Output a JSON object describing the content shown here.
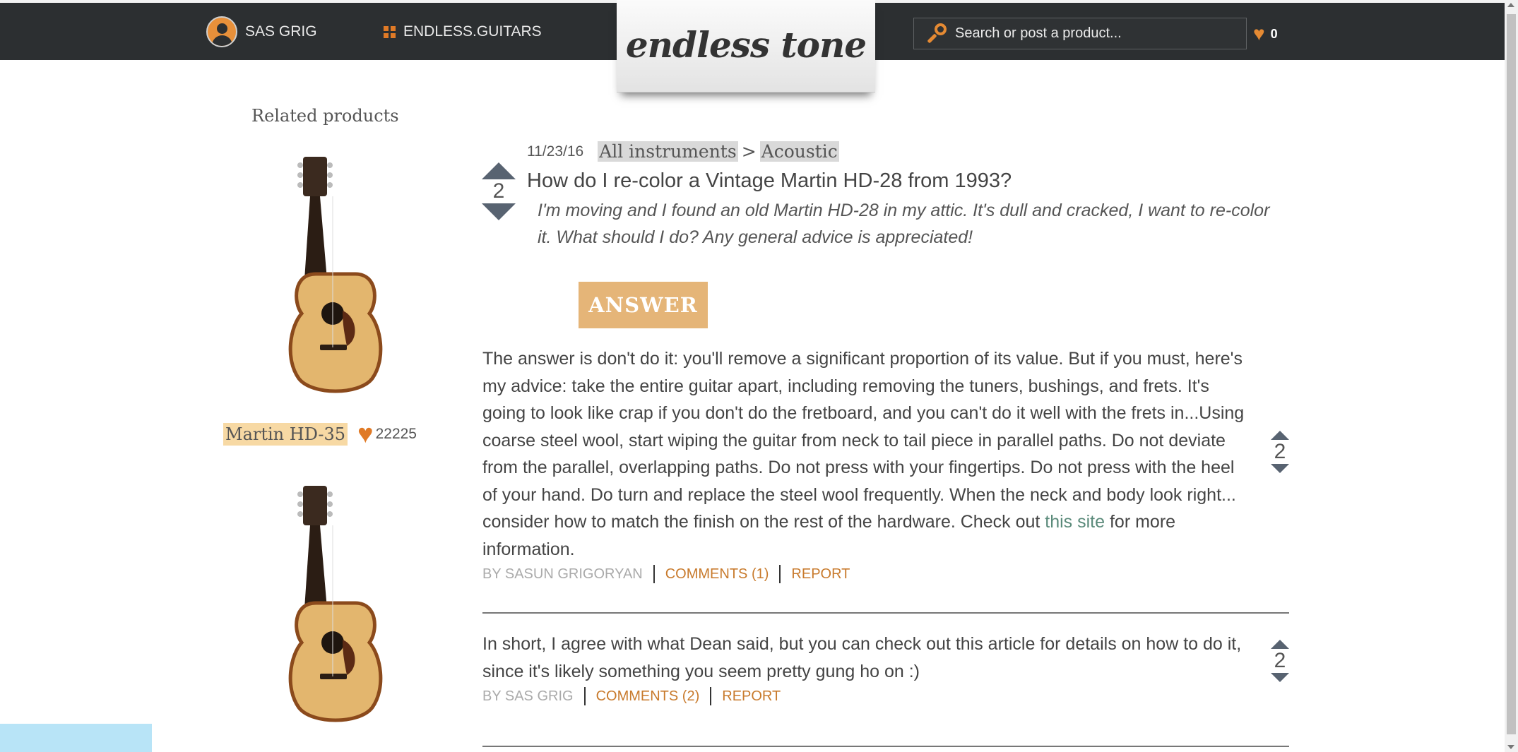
{
  "header": {
    "user_name": "SAS GRIG",
    "store_name": "ENDLESS.GUITARS",
    "logo_text": "endless tone",
    "search": {
      "placeholder": "Search or post a product..."
    },
    "favorites_count": "0"
  },
  "sidebar": {
    "title": "Related products",
    "products": [
      {
        "name": "Martin HD-35",
        "likes": "22225"
      }
    ]
  },
  "question": {
    "date": "11/23/16",
    "breadcrumb": [
      "All instruments",
      "Acoustic"
    ],
    "breadcrumb_separator": ">",
    "votes": "2",
    "title": "How do I re-color a Vintage Martin HD-28 from 1993?",
    "body": "I'm moving and I found an old Martin HD-28 in my attic. It's dull and cracked, I want to re-color it. What should I do? Any general advice is appreciated!"
  },
  "answer_button_label": "ANSWER",
  "answers": [
    {
      "text_before_link": "The answer is don't do it: you'll remove a significant proportion of its value. But if you must, here's my advice: take the entire guitar apart, including removing the tuners, bushings, and frets. It's going to look like crap if you don't do the fretboard, and you can't do it well with the frets in...Using coarse steel wool, start wiping the guitar from neck to tail piece in parallel paths. Do not deviate from the parallel, overlapping paths. Do not press with your fingertips. Do not press with the heel of your hand. Do turn and replace the steel wool frequently. When the neck and body look right... consider how to match the finish on the rest of the hardware. Check out ",
      "link_text": "this site",
      "text_after_link": " for more information.",
      "author": "BY SASUN GRIGORYAN",
      "comments": "COMMENTS (1)",
      "report": "REPORT",
      "votes": "2"
    },
    {
      "text": "In short, I agree with what Dean said, but you can check out this article for details on how to do it, since it's likely something you seem pretty gung ho on :)",
      "author": "BY SAS GRIG",
      "comments": "COMMENTS (2)",
      "report": "REPORT",
      "votes": "2"
    }
  ],
  "colors": {
    "topbar": "#2c2f31",
    "accent_orange": "#e07a26",
    "answer_button": "#e5b578",
    "product_highlight": "#f7d9a4",
    "vote_arrow": "#586371"
  },
  "icons": [
    "avatar-icon",
    "grid-icon",
    "search-icon",
    "heart-icon",
    "vote-up-icon",
    "vote-down-icon"
  ]
}
